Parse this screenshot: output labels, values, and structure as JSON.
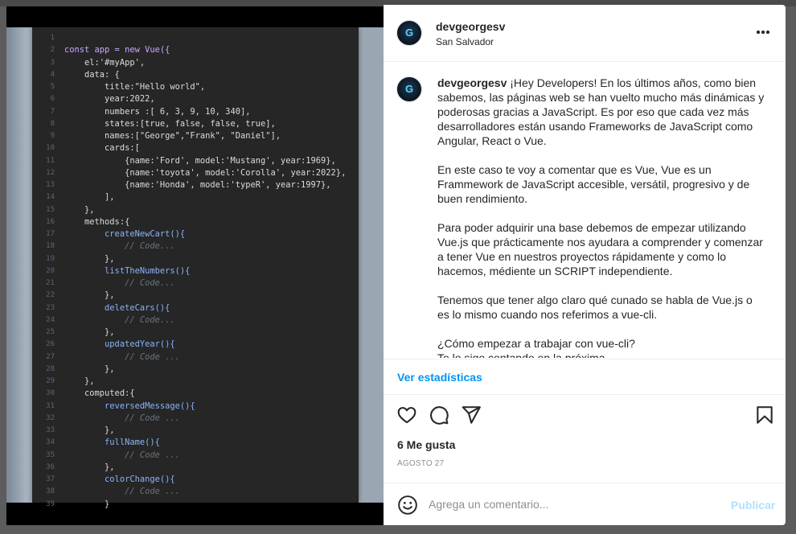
{
  "post": {
    "username": "devgeorgesv",
    "location": "San Salvador",
    "avatar_letter": "G"
  },
  "code_lines": [
    {
      "n": "1",
      "t": "",
      "c": "tx"
    },
    {
      "n": "2",
      "t": "const app = new Vue({",
      "c": "tx kw"
    },
    {
      "n": "3",
      "t": "    el:'#myApp',",
      "c": "tx"
    },
    {
      "n": "4",
      "t": "    data: {",
      "c": "tx"
    },
    {
      "n": "5",
      "t": "        title:\"Hello world\",",
      "c": "tx"
    },
    {
      "n": "6",
      "t": "        year:2022,",
      "c": "tx"
    },
    {
      "n": "7",
      "t": "        numbers :[ 6, 3, 9, 10, 340],",
      "c": "tx"
    },
    {
      "n": "8",
      "t": "        states:[true, false, false, true],",
      "c": "tx"
    },
    {
      "n": "9",
      "t": "        names:[\"George\",\"Frank\", \"Daniel\"],",
      "c": "tx"
    },
    {
      "n": "10",
      "t": "        cards:[",
      "c": "tx"
    },
    {
      "n": "11",
      "t": "            {name:'Ford', model:'Mustang', year:1969},",
      "c": "tx"
    },
    {
      "n": "12",
      "t": "            {name:'toyota', model:'Corolla', year:2022},",
      "c": "tx"
    },
    {
      "n": "13",
      "t": "            {name:'Honda', model:'typeR', year:1997},",
      "c": "tx"
    },
    {
      "n": "14",
      "t": "        ],",
      "c": "tx"
    },
    {
      "n": "15",
      "t": "    },",
      "c": "tx"
    },
    {
      "n": "16",
      "t": "    methods:{",
      "c": "tx"
    },
    {
      "n": "17",
      "t": "        createNewCart(){",
      "c": "tx fn"
    },
    {
      "n": "18",
      "t": "            // Code...",
      "c": "tx cm"
    },
    {
      "n": "19",
      "t": "        },",
      "c": "tx"
    },
    {
      "n": "20",
      "t": "        listTheNumbers(){",
      "c": "tx fn"
    },
    {
      "n": "21",
      "t": "            // Code...",
      "c": "tx cm"
    },
    {
      "n": "22",
      "t": "        },",
      "c": "tx"
    },
    {
      "n": "23",
      "t": "        deleteCars(){",
      "c": "tx fn"
    },
    {
      "n": "24",
      "t": "            // Code...",
      "c": "tx cm"
    },
    {
      "n": "25",
      "t": "        },",
      "c": "tx"
    },
    {
      "n": "26",
      "t": "        updatedYear(){",
      "c": "tx fn"
    },
    {
      "n": "27",
      "t": "            // Code ...",
      "c": "tx cm"
    },
    {
      "n": "28",
      "t": "        },",
      "c": "tx"
    },
    {
      "n": "29",
      "t": "    },",
      "c": "tx"
    },
    {
      "n": "30",
      "t": "    computed:{",
      "c": "tx"
    },
    {
      "n": "31",
      "t": "        reversedMessage(){",
      "c": "tx fn"
    },
    {
      "n": "32",
      "t": "            // Code ...",
      "c": "tx cm"
    },
    {
      "n": "33",
      "t": "        },",
      "c": "tx"
    },
    {
      "n": "34",
      "t": "        fullName(){",
      "c": "tx fn"
    },
    {
      "n": "35",
      "t": "            // Code ...",
      "c": "tx cm"
    },
    {
      "n": "36",
      "t": "        },",
      "c": "tx"
    },
    {
      "n": "37",
      "t": "        colorChange(){",
      "c": "tx fn"
    },
    {
      "n": "38",
      "t": "            // Code ...",
      "c": "tx cm"
    },
    {
      "n": "39",
      "t": "        }",
      "c": "tx"
    }
  ],
  "caption": {
    "p1": "¡Hey Developers! En los últimos años, como bien sabemos, las páginas web se han vuelto mucho más dinámicas y poderosas gracias a JavaScript. Es por eso que cada vez más desarrolladores están usando Frameworks de JavaScript como Angular, React o Vue.",
    "p2": "En este caso te voy a comentar que es Vue, Vue es un Frammework de JavaScript accesible, versátil, progresivo y de buen rendimiento.",
    "p3": "Para poder adquirir una base debemos de empezar utilizando Vue.js que prácticamente nos ayudara a comprender y comenzar a tener Vue en nuestros proyectos rápidamente y como lo hacemos, médiente un SCRIPT independiente.",
    "p4": "Tenemos que tener algo claro qué cunado se habla de Vue.js o es lo mismo cuando nos referimos a vue-cli.",
    "p5": "¿Cómo empezar a trabajar con vue-cli?",
    "p6": "Te lo sigo contando en la próxima"
  },
  "stats_link": "Ver estadísticas",
  "likes": "6 Me gusta",
  "date": "AGOSTO 27",
  "comment": {
    "placeholder": "Agrega un comentario...",
    "publish_label": "Publicar"
  },
  "colors": {
    "accent": "#0095f6",
    "publish_disabled": "#b2dffc",
    "text": "#262626",
    "muted": "#8e8e8e"
  },
  "icons": [
    "more-icon",
    "heart-icon",
    "comment-icon",
    "share-icon",
    "bookmark-icon",
    "emoji-icon"
  ]
}
